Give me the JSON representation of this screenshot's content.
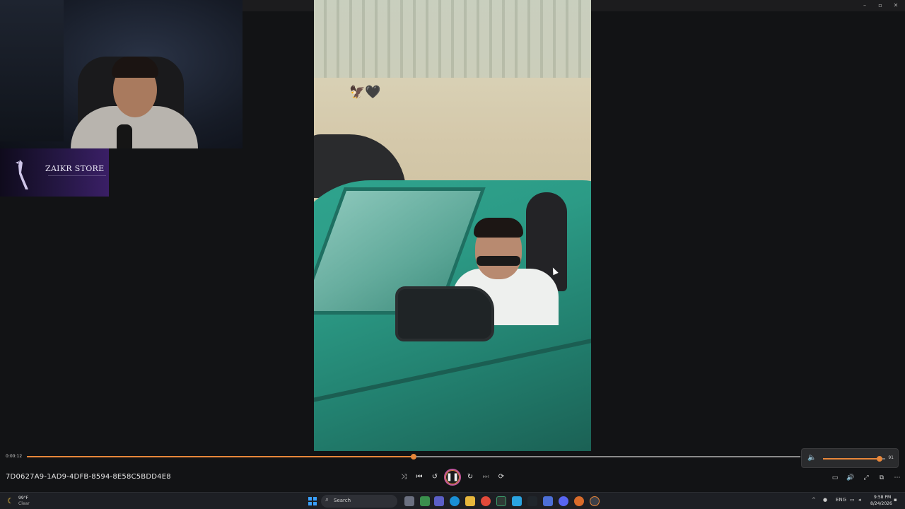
{
  "store": {
    "name": "ZAIKR STORE"
  },
  "player": {
    "elapsed": "0:00:12",
    "progress_fraction": 0.5,
    "filename": "7D0627A9-1AD9-4DFB-8594-8E58C5BDD4E8",
    "volume_value": "91",
    "volume_fraction": 0.91
  },
  "video": {
    "overlay_emoji": "🦅🖤"
  },
  "controls": {
    "shuffle_icon": "⤨",
    "previous_icon": "⏮",
    "rewind_icon": "↺",
    "pause_icon": "❚❚",
    "forward_icon": "↻",
    "next_icon": "⏭",
    "repeat_icon": "⟳"
  },
  "window": {
    "minimize": "–",
    "maximize": "▫",
    "close": "✕"
  },
  "taskbar": {
    "weather_temp": "99°F",
    "weather_condition": "Clear",
    "search_placeholder": "Search",
    "language": "ENG",
    "clock_time": "9:58 PM",
    "clock_date": "8/24/2026"
  },
  "colors": {
    "accent": "#e8873a",
    "play_ring": "#c0569a",
    "taskbar": "#1d1f24"
  }
}
